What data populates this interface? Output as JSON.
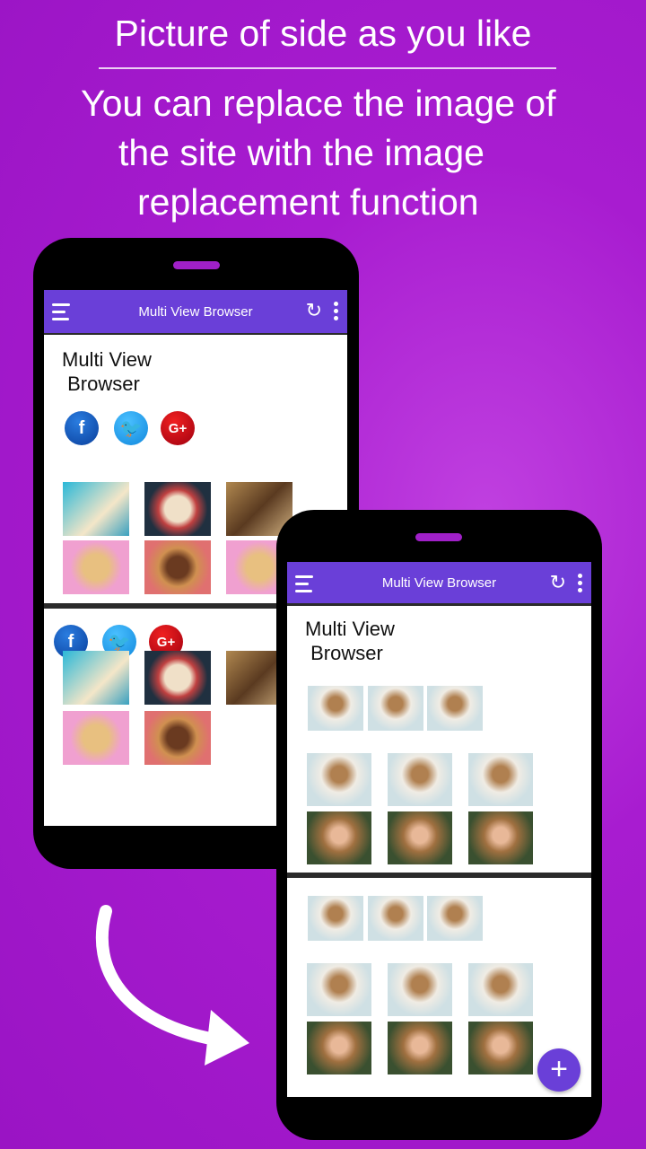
{
  "promo": {
    "headline": "Picture of side as you like",
    "subtitle_lines": [
      "You can replace the image of",
      "the site with the image",
      "replacement function"
    ]
  },
  "app": {
    "title": "Multi View Browser",
    "page_heading": "Multi View\n Browser",
    "social": {
      "facebook": "f",
      "twitter": "t",
      "google_plus": "G+"
    },
    "refresh_icon": "↻",
    "fab_label": "+"
  },
  "colors": {
    "background": "#a81cd0",
    "toolbar": "#6a3fd8",
    "fab": "#6a3fd8"
  }
}
